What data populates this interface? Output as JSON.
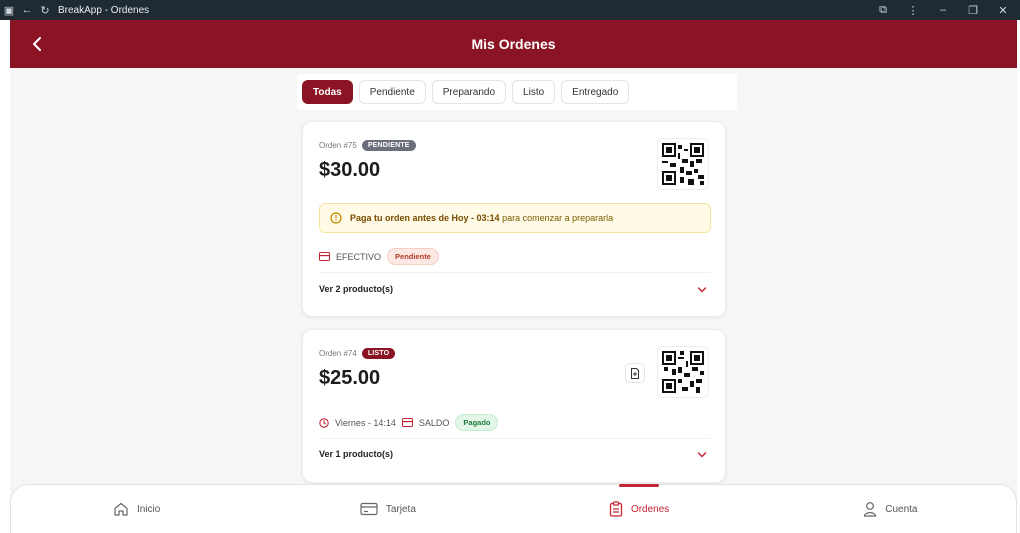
{
  "browser": {
    "title": "BreakApp - Ordenes"
  },
  "header": {
    "title": "Mis Ordenes"
  },
  "tabs": [
    {
      "label": "Todas",
      "active": true
    },
    {
      "label": "Pendiente",
      "active": false
    },
    {
      "label": "Preparando",
      "active": false
    },
    {
      "label": "Listo",
      "active": false
    },
    {
      "label": "Entregado",
      "active": false
    }
  ],
  "orders": [
    {
      "label": "Orden #75",
      "status": "PENDIENTE",
      "status_color": "#6b6f7a",
      "amount": "$30.00",
      "alert": {
        "bold": "Paga tu orden antes de Hoy - 03:14",
        "rest": "para comenzar a prepararla"
      },
      "payment_method": "EFECTIVO",
      "payment_status": "Pendiente",
      "products": "Ver 2 producto(s)"
    },
    {
      "label": "Orden #74",
      "status": "LISTO",
      "status_color": "#8b1424",
      "amount": "$25.00",
      "time": "Viernes - 14:14",
      "payment_method": "SALDO",
      "payment_status": "Pagado",
      "products": "Ver 1 producto(s)"
    }
  ],
  "nav": [
    {
      "label": "Inicio",
      "icon": "home-icon",
      "active": false
    },
    {
      "label": "Tarjeta",
      "icon": "card-icon",
      "active": false
    },
    {
      "label": "Ordenes",
      "icon": "clipboard-icon",
      "active": true
    },
    {
      "label": "Cuenta",
      "icon": "user-icon",
      "active": false
    }
  ],
  "colors": {
    "brand": "#8b1424",
    "accent": "#c62634"
  }
}
